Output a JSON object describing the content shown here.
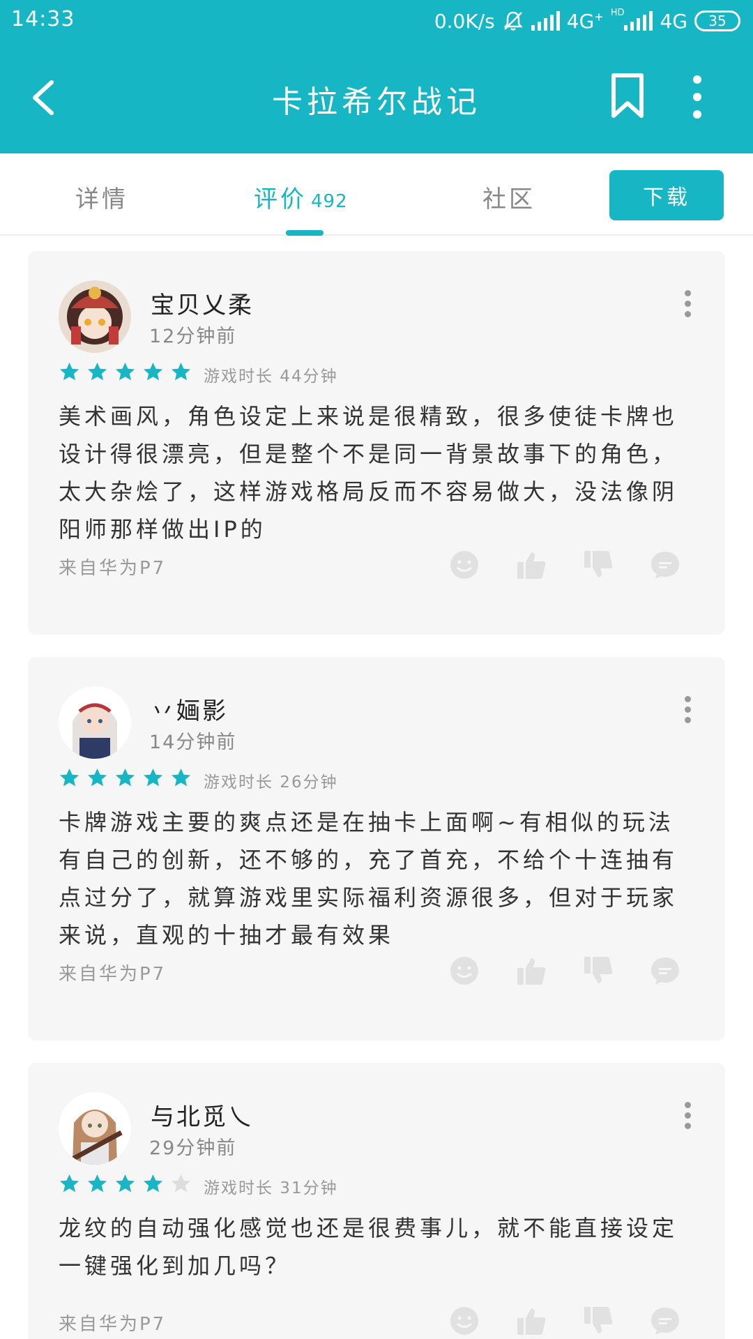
{
  "status_bar": {
    "time": "14:33",
    "network_speed": "0.0K/s",
    "sim1_label": "4G",
    "sim2_hd": "HD",
    "sim2_label": "4G",
    "battery": "35",
    "icons": [
      "mute-bell-icon",
      "signal-icon",
      "signal-icon"
    ]
  },
  "app_bar": {
    "title": "卡拉希尔战记",
    "icons": [
      "back-arrow-icon",
      "bookmark-icon",
      "more-vertical-icon"
    ]
  },
  "tabs": {
    "items": [
      {
        "label": "详情",
        "count": "",
        "active": false
      },
      {
        "label": "评价",
        "count": "492",
        "active": true
      },
      {
        "label": "社区",
        "count": "",
        "active": false
      }
    ],
    "download_label": "下载"
  },
  "colors": {
    "accent": "#17b6c4",
    "card_bg": "#f6f6f6",
    "star_empty": "#dddddd"
  },
  "reviews": [
    {
      "username": "宝贝乂柔",
      "time": "12分钟前",
      "rating": 5,
      "playtime": "游戏时长 44分钟",
      "content": "美术画风，角色设定上来说是很精致，很多使徒卡牌也设计得很漂亮，但是整个不是同一背景故事下的角色，太大杂烩了，这样游戏格局反而不容易做大，没法像阴阳师那样做出IP的",
      "device": "来自华为P7",
      "actions": [
        "emoji-icon",
        "thumb-up-icon",
        "thumb-down-icon",
        "comment-icon"
      ]
    },
    {
      "username": "丷婳影",
      "time": "14分钟前",
      "rating": 5,
      "playtime": "游戏时长 26分钟",
      "content": "卡牌游戏主要的爽点还是在抽卡上面啊~有相似的玩法有自己的创新，还不够的，充了首充，不给个十连抽有点过分了，就算游戏里实际福利资源很多，但对于玩家来说，直观的十抽才最有效果",
      "device": "来自华为P7",
      "actions": [
        "emoji-icon",
        "thumb-up-icon",
        "thumb-down-icon",
        "comment-icon"
      ]
    },
    {
      "username": "与北觅乀",
      "time": "29分钟前",
      "rating": 4,
      "playtime": "游戏时长 31分钟",
      "content": "龙纹的自动强化感觉也还是很费事儿，就不能直接设定一键强化到加几吗？",
      "device": "来自华为P7",
      "actions": [
        "emoji-icon",
        "thumb-up-icon",
        "thumb-down-icon",
        "comment-icon"
      ]
    }
  ]
}
